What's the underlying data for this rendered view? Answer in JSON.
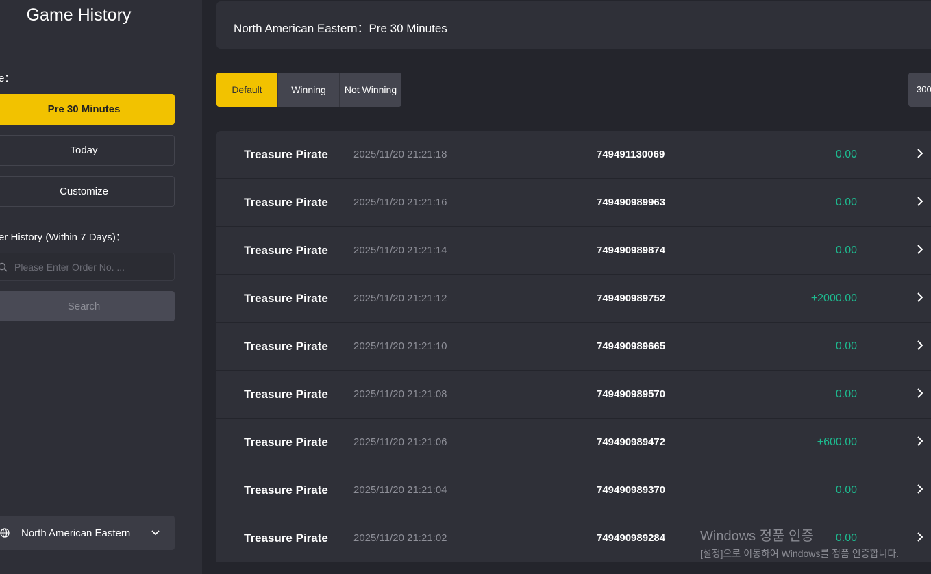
{
  "sidebar": {
    "title": "Game History",
    "range_label": "e：",
    "range_options": [
      "Pre 30 Minutes",
      "Today",
      "Customize"
    ],
    "order_history_label": "er History (Within 7 Days)：",
    "search_placeholder": "Please Enter Order No. ...",
    "search_button": "Search",
    "timezone": "North American Eastern"
  },
  "topbar": {
    "text": "North American Eastern：Pre 30 Minutes"
  },
  "filters": {
    "tabs": [
      "Default",
      "Winning",
      "Not Winning"
    ],
    "count": "300"
  },
  "records": [
    {
      "game": "Treasure Pirate",
      "time": "2025/11/20 21:21:18",
      "order": "749491130069",
      "amount": "0.00"
    },
    {
      "game": "Treasure Pirate",
      "time": "2025/11/20 21:21:16",
      "order": "749490989963",
      "amount": "0.00"
    },
    {
      "game": "Treasure Pirate",
      "time": "2025/11/20 21:21:14",
      "order": "749490989874",
      "amount": "0.00"
    },
    {
      "game": "Treasure Pirate",
      "time": "2025/11/20 21:21:12",
      "order": "749490989752",
      "amount": "+2000.00"
    },
    {
      "game": "Treasure Pirate",
      "time": "2025/11/20 21:21:10",
      "order": "749490989665",
      "amount": "0.00"
    },
    {
      "game": "Treasure Pirate",
      "time": "2025/11/20 21:21:08",
      "order": "749490989570",
      "amount": "0.00"
    },
    {
      "game": "Treasure Pirate",
      "time": "2025/11/20 21:21:06",
      "order": "749490989472",
      "amount": "+600.00"
    },
    {
      "game": "Treasure Pirate",
      "time": "2025/11/20 21:21:04",
      "order": "749490989370",
      "amount": "0.00"
    },
    {
      "game": "Treasure Pirate",
      "time": "2025/11/20 21:21:02",
      "order": "749490989284",
      "amount": "0.00"
    }
  ],
  "watermark": {
    "line1": "Windows 정품 인증",
    "line2": "[설정]으로 이동하여 Windows를 정품 인증합니다."
  },
  "colors": {
    "accent": "#f2c200",
    "win_green": "#1dba8f",
    "background": "#24252c",
    "panel": "#2f3038"
  }
}
